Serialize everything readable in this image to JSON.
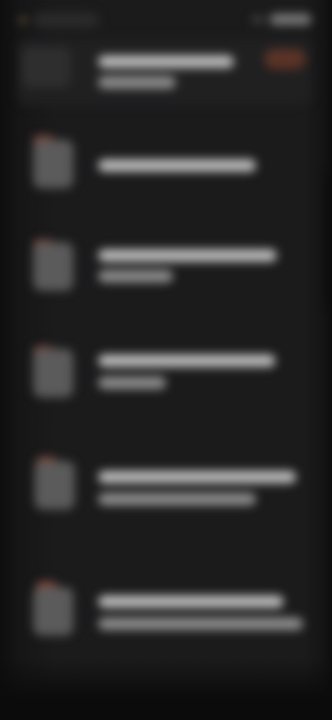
{
  "screen": {
    "description_visible": false
  },
  "feed": {
    "items": [
      {
        "kind": "featured"
      },
      {
        "kind": "article"
      },
      {
        "kind": "article"
      },
      {
        "kind": "article"
      },
      {
        "kind": "article"
      },
      {
        "kind": "article"
      }
    ]
  },
  "colors": {
    "background": "#1b1b1c",
    "card": "#202021",
    "accent": "#8a4a3a",
    "text": "#bdbdbd"
  },
  "icons": {
    "status_dot": "status-indicator-icon",
    "thumbnail": "article-thumbnail-icon"
  }
}
